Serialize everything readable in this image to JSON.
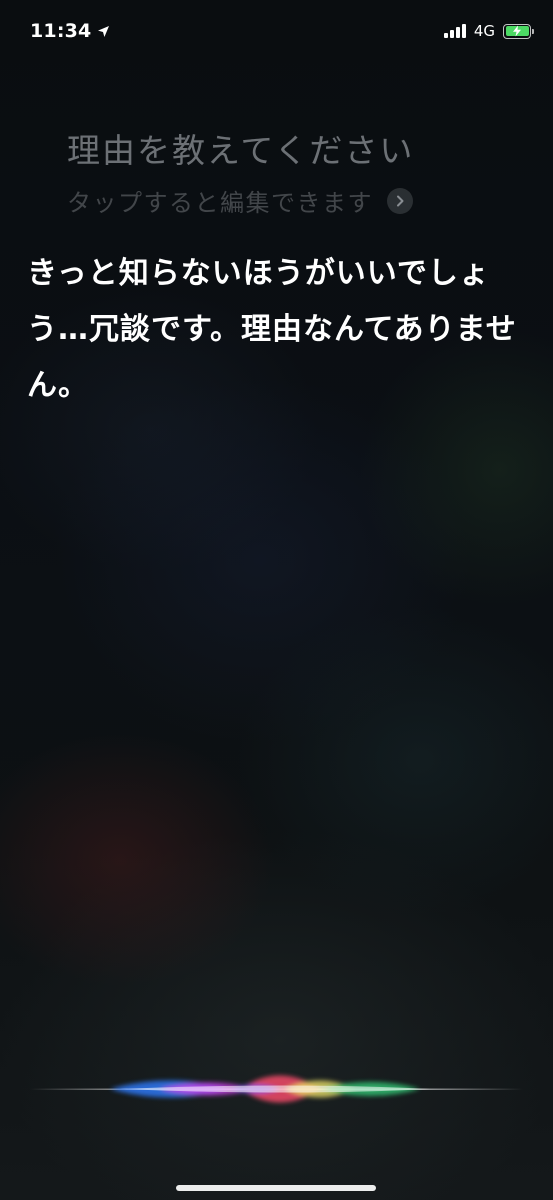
{
  "status_bar": {
    "time": "11:34",
    "network": "4G",
    "icons": {
      "location": "location-arrow-icon",
      "signal": "cellular-signal-icon",
      "battery": "battery-charging-icon"
    },
    "battery_color": "#4cd964"
  },
  "siri": {
    "query": "理由を教えてください",
    "edit_hint": "タップすると編集できます",
    "edit_icon": "chevron-right-icon",
    "response": "きっと知らないほうがいいでしょう…冗談です。理由なんてありません。",
    "wave_colors": [
      "#2f7dff",
      "#e040fb",
      "#ff4d6d",
      "#f5e96b",
      "#33d17a"
    ]
  }
}
